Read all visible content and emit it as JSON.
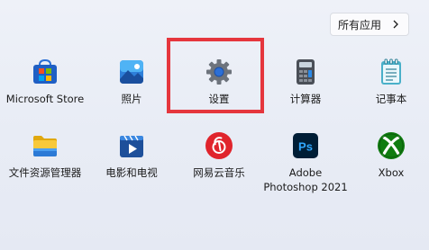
{
  "header": {
    "all_apps_label": "所有应用"
  },
  "apps": [
    {
      "name": "Microsoft Store",
      "icon": "microsoft-store-icon"
    },
    {
      "name": "照片",
      "icon": "photos-icon"
    },
    {
      "name": "设置",
      "icon": "settings-gear-icon"
    },
    {
      "name": "计算器",
      "icon": "calculator-icon"
    },
    {
      "name": "记事本",
      "icon": "notepad-icon"
    },
    {
      "name": "文件资源管理器",
      "icon": "file-explorer-icon"
    },
    {
      "name": "电影和电视",
      "icon": "movies-tv-icon"
    },
    {
      "name": "网易云音乐",
      "icon": "netease-music-icon"
    },
    {
      "name_line1": "Adobe",
      "name_line2": "Photoshop 2021",
      "icon": "photoshop-icon"
    },
    {
      "name": "Xbox",
      "icon": "xbox-icon"
    }
  ],
  "colors": {
    "highlight": "#e5363d"
  }
}
